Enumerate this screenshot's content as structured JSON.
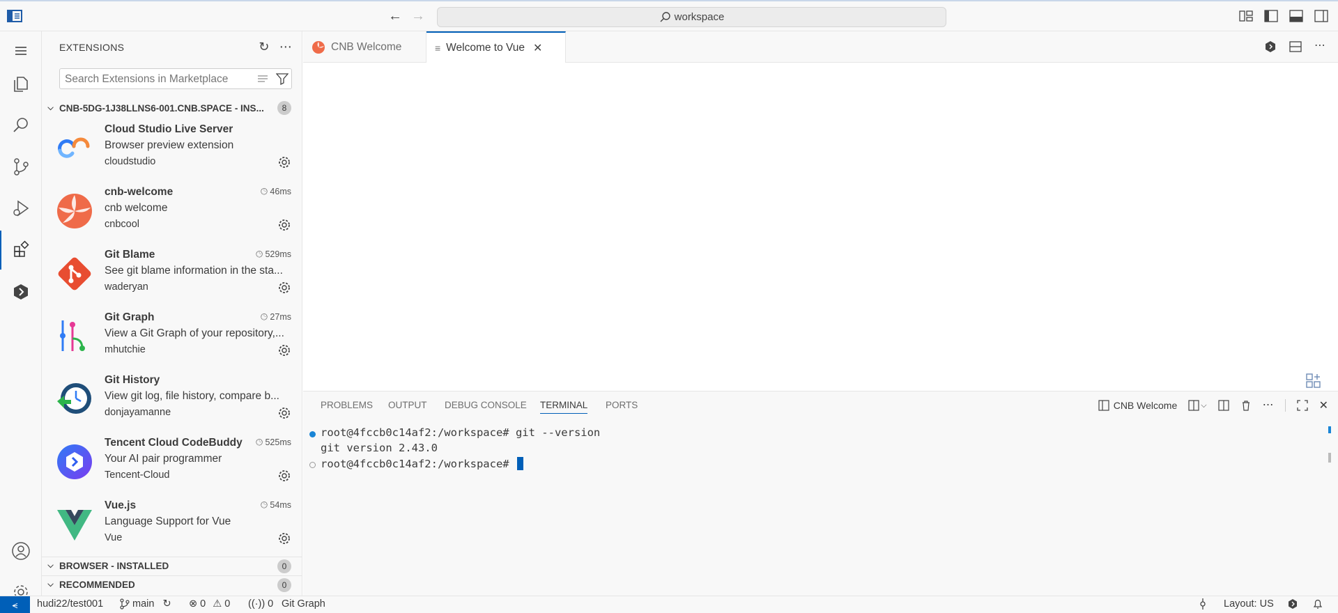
{
  "titlebar": {
    "search_text": "workspace"
  },
  "sidebar": {
    "title": "EXTENSIONS",
    "search_placeholder": "Search Extensions in Marketplace",
    "sections": [
      {
        "label": "CNB-5DG-1J38LLNS6-001.CNB.SPACE - INS...",
        "count": "8"
      },
      {
        "label": "BROWSER - INSTALLED",
        "count": "0"
      },
      {
        "label": "RECOMMENDED",
        "count": "0"
      }
    ],
    "extensions": [
      {
        "name": "Cloud Studio Live Server",
        "desc": "Browser preview extension",
        "publisher": "cloudstudio",
        "timing": ""
      },
      {
        "name": "cnb-welcome",
        "desc": "cnb welcome",
        "publisher": "cnbcool",
        "timing": "46ms"
      },
      {
        "name": "Git Blame",
        "desc": "See git blame information in the sta...",
        "publisher": "waderyan",
        "timing": "529ms"
      },
      {
        "name": "Git Graph",
        "desc": "View a Git Graph of your repository,...",
        "publisher": "mhutchie",
        "timing": "27ms"
      },
      {
        "name": "Git History",
        "desc": "View git log, file history, compare b...",
        "publisher": "donjayamanne",
        "timing": ""
      },
      {
        "name": "Tencent Cloud CodeBuddy",
        "desc": "Your AI pair programmer",
        "publisher": "Tencent-Cloud",
        "timing": "525ms"
      },
      {
        "name": "Vue.js",
        "desc": "Language Support for Vue",
        "publisher": "Vue",
        "timing": "54ms"
      }
    ]
  },
  "tabs": [
    {
      "label": "CNB Welcome"
    },
    {
      "label": "Welcome to Vue"
    }
  ],
  "panel": {
    "tabs": [
      "PROBLEMS",
      "OUTPUT",
      "DEBUG CONSOLE",
      "TERMINAL",
      "PORTS"
    ],
    "terminal_name": "CNB Welcome",
    "lines": [
      "root@4fccb0c14af2:/workspace# git --version",
      "git version 2.43.0",
      "root@4fccb0c14af2:/workspace# "
    ]
  },
  "statusbar": {
    "repo": "hudi22/test001",
    "branch": "main",
    "errors": "0",
    "warnings": "0",
    "ports": "0",
    "git_graph": "Git Graph",
    "layout": "Layout: US"
  },
  "colors": {
    "accent": "#005fb8",
    "sidebar_bg": "#f8f8f8"
  }
}
